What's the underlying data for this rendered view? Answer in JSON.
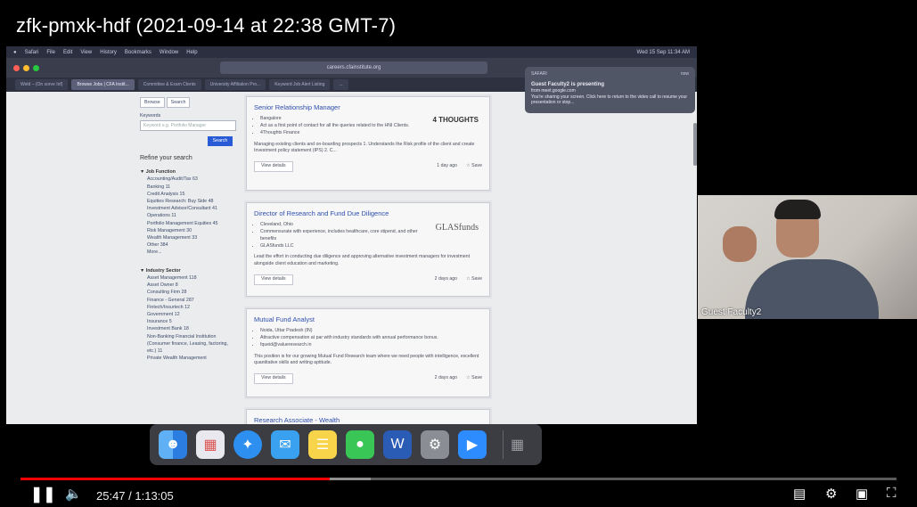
{
  "video": {
    "title": "zfk-pmxk-hdf (2021-09-14 at 22:38 GMT-7)",
    "time_display": "25:47 / 1:13:05",
    "progress_percent": 35.3,
    "buffered_percent": 40
  },
  "menubar": {
    "items": [
      "Safari",
      "File",
      "Edit",
      "View",
      "History",
      "Bookmarks",
      "Window",
      "Help"
    ],
    "clock": "Wed 15 Sep 11:34 AM"
  },
  "browser": {
    "url": "careers.cfainstitute.org",
    "tabs": [
      "Weld – (On sorve Inf)",
      "Browse Jobs | CFA Instit...",
      "Committee & Exam Ctents",
      "University Affiliation Pro...",
      "Keyword Job Alert Listing",
      "..."
    ]
  },
  "notification": {
    "app": "SAFARI",
    "time": "now",
    "title": "Guest Faculty2 is presenting",
    "source": "from meet.google.com",
    "body": "You're sharing your screen. Click here to return to the video call to resume your presentation or stop..."
  },
  "filters": {
    "tabs": [
      "Browse",
      "Search"
    ],
    "keywords_label": "Keywords",
    "keywords_placeholder": "Keyword e.g. Portfolio Manager",
    "search_button": "Search",
    "refine_title": "Refine your search",
    "job_function_title": "Job Function",
    "job_function_items": [
      "Accounting/Audit/Tax 63",
      "Banking 11",
      "Credit Analysis 15",
      "Equities Research: Buy Side 48",
      "Investment Advisor/Consultant 41",
      "Operations 11",
      "Portfolio Management Equities 45",
      "Risk Management 30",
      "Wealth Management 33",
      "Other 384",
      "More..."
    ],
    "industry_title": "Industry Sector",
    "industry_items": [
      "Asset Management 118",
      "Asset Owner 8",
      "Consulting Firm 28",
      "Finance - General 287",
      "Fintech/Insurtech 12",
      "Government 12",
      "Insurance 5",
      "Investment Bank 18",
      "Non-Banking Financial Institution (Consumer finance, Leasing, factoring, etc.) 11",
      "Private Wealth Management"
    ]
  },
  "jobs": [
    {
      "title": "Senior Relationship Manager",
      "bullets": [
        "Bangalore",
        "Act as a first point of contact for all the queries related to the HNI Clients.",
        "4Thoughts Finance"
      ],
      "desc": "Managing existing clients and on-boarding prospects 1. Understands the Risk profile of the client and create Investment policy statement (IPS) 2. C...",
      "logo": "4 THOUGHTS",
      "posted": "1 day ago",
      "view": "View details",
      "save": "Save"
    },
    {
      "title": "Director of Research and Fund Due Diligence",
      "bullets": [
        "Cleveland, Ohio",
        "Commensurate with experience, includes healthcare, core stipend, and other benefits",
        "GLASfunds LLC"
      ],
      "desc": "Lead the effort in conducting due diligence and approving alternative investment managers for investment alongside client education and marketing.",
      "logo": "GLASfunds",
      "posted": "2 days ago",
      "view": "View details",
      "save": "Save"
    },
    {
      "title": "Mutual Fund Analyst",
      "bullets": [
        "Noida, Uttar Pradesh (IN)",
        "Attractive compensation at par with industry standards with annual performance bonus.",
        "fqueid@valueresearch.in"
      ],
      "desc": "This position is for our growing Mutual Fund Research team where we need people with intelligence, excellent quantitative skills and writing aptitude.",
      "logo": "",
      "posted": "2 days ago",
      "view": "View details",
      "save": "Save"
    },
    {
      "title": "Research Associate - Wealth",
      "bullets": [],
      "desc": "",
      "logo": "",
      "posted": "",
      "view": "",
      "save": ""
    }
  ],
  "webcam": {
    "name": "Guest Faculty2"
  },
  "dock_icons": [
    "finder-icon",
    "launchpad-icon",
    "safari-icon",
    "mail-icon",
    "notes-icon",
    "messages-icon",
    "word-icon",
    "system-preferences-icon",
    "zoom-icon",
    "trash-icon"
  ],
  "colors": {
    "progress": "#ff0000",
    "link": "#2d4fae",
    "search_button": "#2a5bd7"
  }
}
